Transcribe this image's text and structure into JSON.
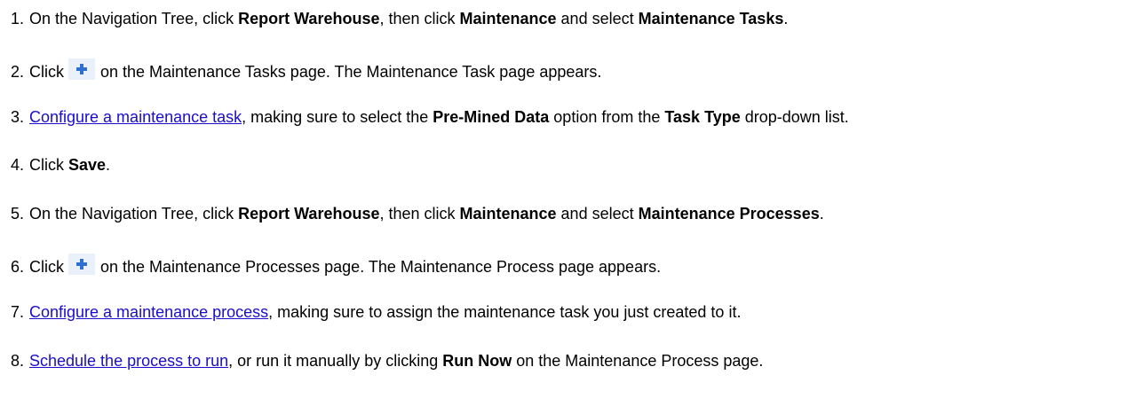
{
  "steps": [
    {
      "number": "1.",
      "t1": "On the Navigation Tree, click ",
      "b1": "Report Warehouse",
      "t2": ", then click ",
      "b2": "Maintenance",
      "t3": " and select ",
      "b3": "Maintenance Tasks",
      "t4": "."
    },
    {
      "number": "2.",
      "t1": "Click",
      "icon": "add-plus-icon",
      "t2": "on the Maintenance Tasks page. The Maintenance Task page appears."
    },
    {
      "number": "3.",
      "link": "Configure a maintenance task",
      "t1": ", making sure to select the ",
      "b1": "Pre-Mined Data",
      "t2": " option from the ",
      "b2": "Task Type",
      "t3": " drop-down list."
    },
    {
      "number": "4.",
      "t1": "Click ",
      "b1": "Save",
      "t2": "."
    },
    {
      "number": "5.",
      "t1": "On the Navigation Tree, click ",
      "b1": "Report Warehouse",
      "t2": ", then click ",
      "b2": "Maintenance",
      "t3": " and select ",
      "b3": "Maintenance Processes",
      "t4": "."
    },
    {
      "number": "6.",
      "t1": "Click",
      "icon": "add-plus-icon",
      "t2": "on the Maintenance Processes page. The Maintenance Process page appears."
    },
    {
      "number": "7.",
      "link": "Configure a maintenance process",
      "t1": ", making sure to assign the maintenance task you just created to it."
    },
    {
      "number": "8.",
      "link": "Schedule the process to run",
      "t1": ", or run it manually by clicking ",
      "b1": "Run Now",
      "t2": " on the Maintenance Process page."
    }
  ],
  "colors": {
    "link": "#1a0dcc",
    "icon_plus": "#2f6fd0",
    "icon_bg": "#eaf1fa"
  }
}
